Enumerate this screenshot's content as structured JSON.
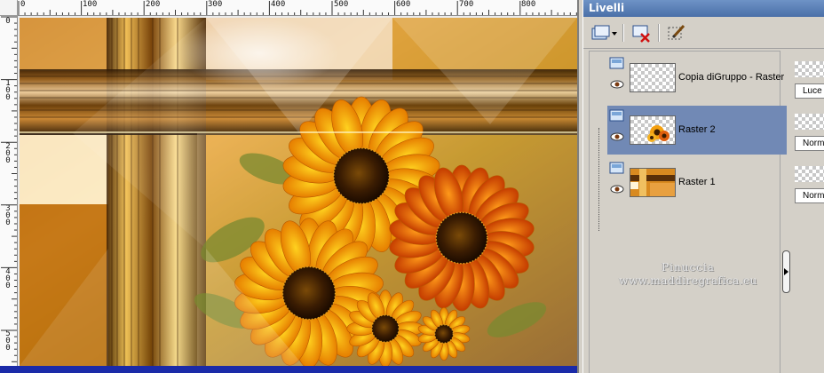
{
  "rulers": {
    "top_labels": [
      "0",
      "100",
      "200",
      "300",
      "400",
      "500",
      "600",
      "700",
      "800"
    ],
    "left_labels": [
      "0",
      "100",
      "200",
      "300",
      "400",
      "500"
    ]
  },
  "panel": {
    "title": "Livelli"
  },
  "toolbar": {
    "new_layer_icon": "new-layer-dropdown-icon",
    "delete_layer_icon": "delete-layer-icon",
    "edit_selection_icon": "edit-brush-icon"
  },
  "layers": [
    {
      "name": "Copia diGruppo - Raster",
      "selected": false,
      "thumbnail": "transparent"
    },
    {
      "name": "Raster 2",
      "selected": true,
      "thumbnail": "sunflowers"
    },
    {
      "name": "Raster 1",
      "selected": false,
      "thumbnail": "background"
    }
  ],
  "properties": [
    {
      "blend_mode": "Luce"
    },
    {
      "blend_mode": "Normale"
    },
    {
      "blend_mode": "Normale"
    }
  ],
  "watermark": {
    "line1": "Pinuccia",
    "line2": "www.maddiregrafica.eu"
  },
  "colors": {
    "title_bar": "#5a7fb6",
    "selected_row": "#7189b5",
    "canvas_bottom_strip": "#1a2aa8"
  }
}
